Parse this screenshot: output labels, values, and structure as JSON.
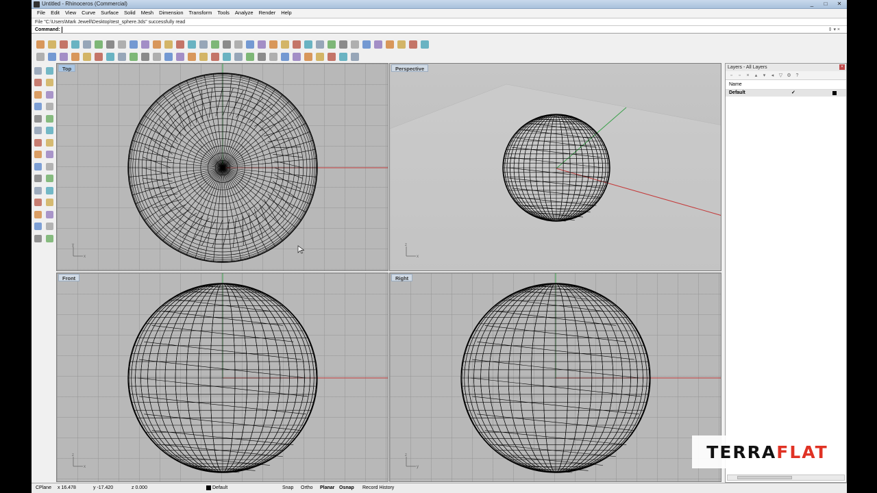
{
  "window": {
    "title": "Untitled - Rhinoceros (Commercial)",
    "controls": [
      "_",
      "□",
      "✕"
    ]
  },
  "menu": [
    "File",
    "Edit",
    "View",
    "Curve",
    "Surface",
    "Solid",
    "Mesh",
    "Dimension",
    "Transform",
    "Tools",
    "Analyze",
    "Render",
    "Help"
  ],
  "command": {
    "history": "File \"C:\\Users\\Mark Jewell\\Desktop\\test_sphere.3ds\" successfully read",
    "prompt": "Command:"
  },
  "viewports": {
    "top": {
      "label": "Top"
    },
    "perspective": {
      "label": "Perspective"
    },
    "front": {
      "label": "Front"
    },
    "right": {
      "label": "Right"
    }
  },
  "layers": {
    "title": "Layers - All Layers",
    "column_name": "Name",
    "rows": [
      {
        "name": "Default",
        "current": "✓",
        "color": "#000000"
      }
    ]
  },
  "status": {
    "cplane": "CPlane",
    "x": "x 16.478",
    "y": "y -17.420",
    "z": "z 0.000",
    "layer": "Default",
    "snap": "Snap",
    "ortho": "Ortho",
    "planar": "Planar",
    "osnap": "Osnap",
    "record": "Record History"
  },
  "watermark": {
    "part1": "TERRA",
    "part2": "FLAT"
  },
  "colors": {
    "x_axis": "#c43a3a",
    "y_axis": "#3aa04a",
    "wire": "#000000"
  }
}
